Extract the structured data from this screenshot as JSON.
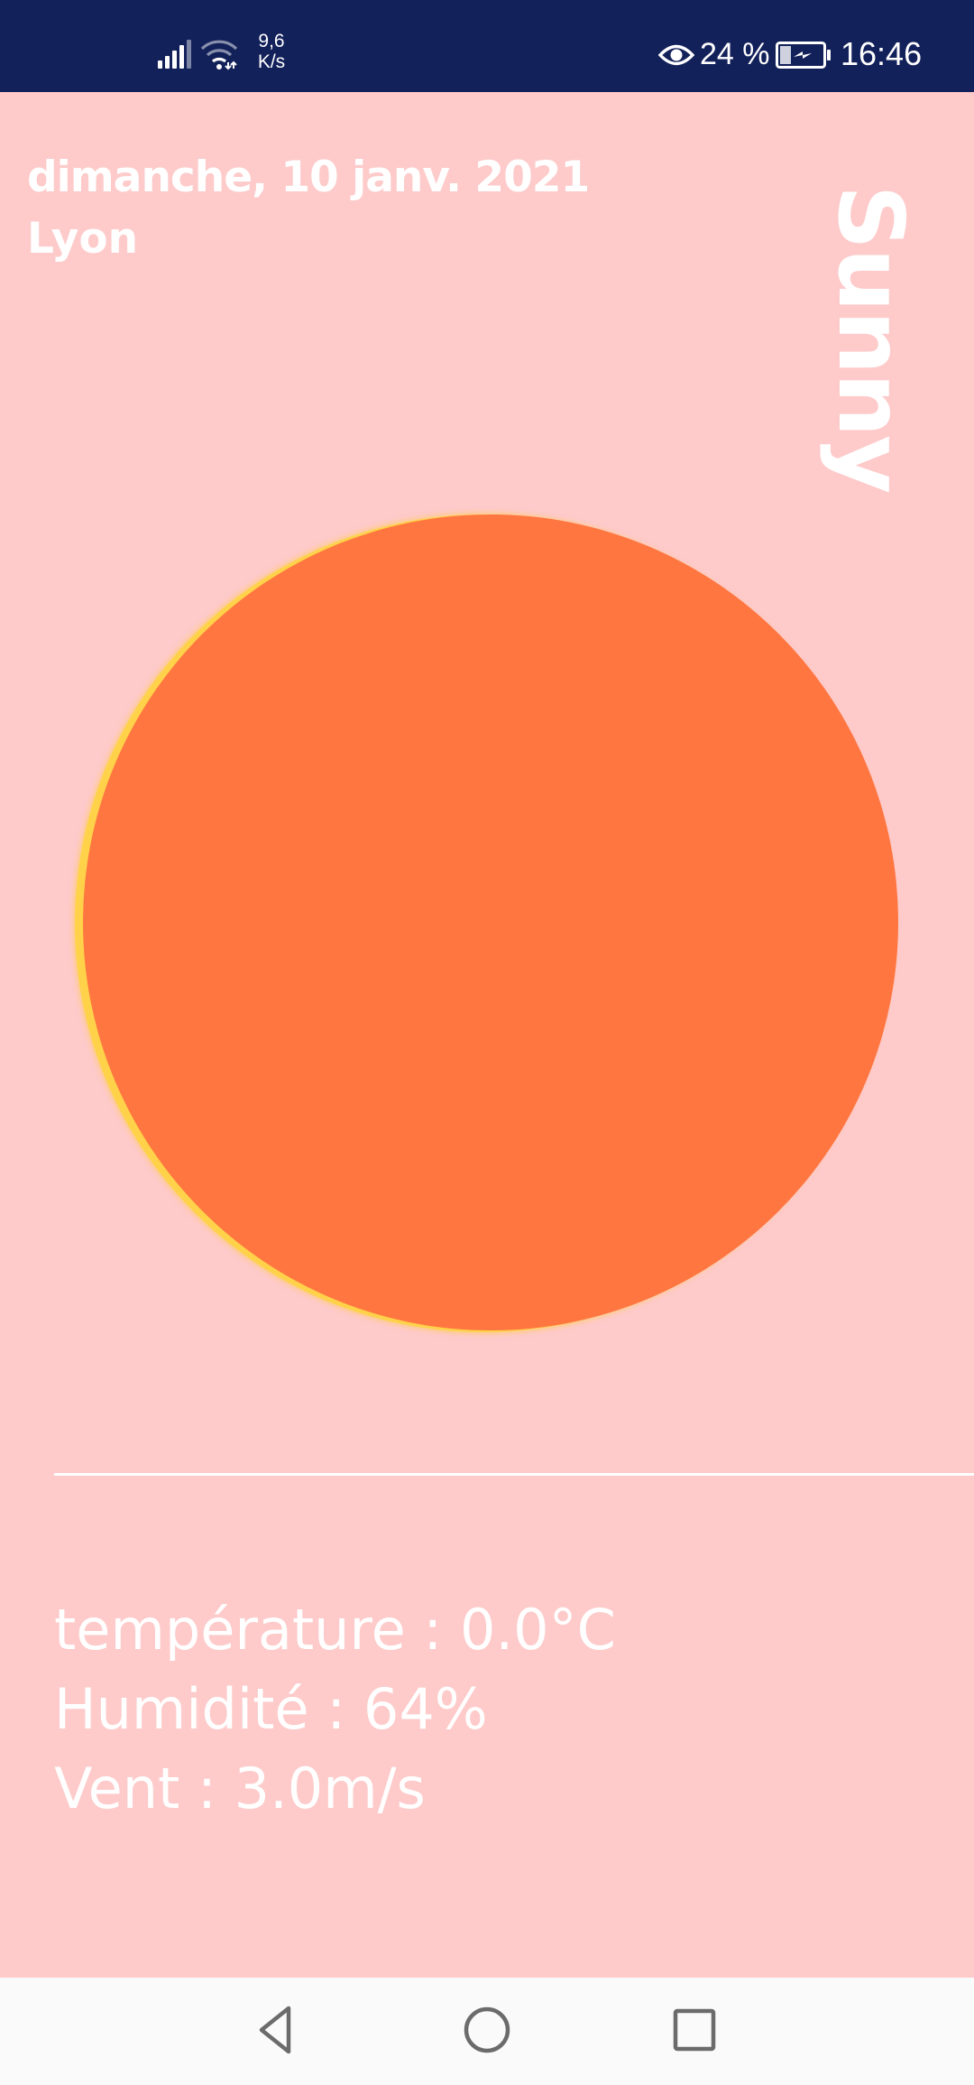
{
  "status_bar": {
    "net_speed_value": "9,6",
    "net_speed_unit": "K/s",
    "battery_percent": "24 %",
    "time": "16:46",
    "icons": [
      "signal-icon",
      "wifi-icon",
      "eye-icon",
      "battery-charging-icon"
    ]
  },
  "weather": {
    "date": "dimanche, 10 janv. 2021",
    "city": "Lyon",
    "condition": "Sunny",
    "temperature": "température : 0.0°C",
    "humidity": "Humidité : 64%",
    "wind": "Vent : 3.0m/s"
  },
  "nav_bar": {
    "icons": [
      "back-icon",
      "home-icon",
      "recents-icon"
    ]
  },
  "colors": {
    "status_bar_bg": "#13215A",
    "background": "#FECACA",
    "sun": "#FF7640",
    "sun_edge": "#FFD24A",
    "text": "#FFFFFF",
    "nav_bar_bg": "#FAFAFA"
  }
}
